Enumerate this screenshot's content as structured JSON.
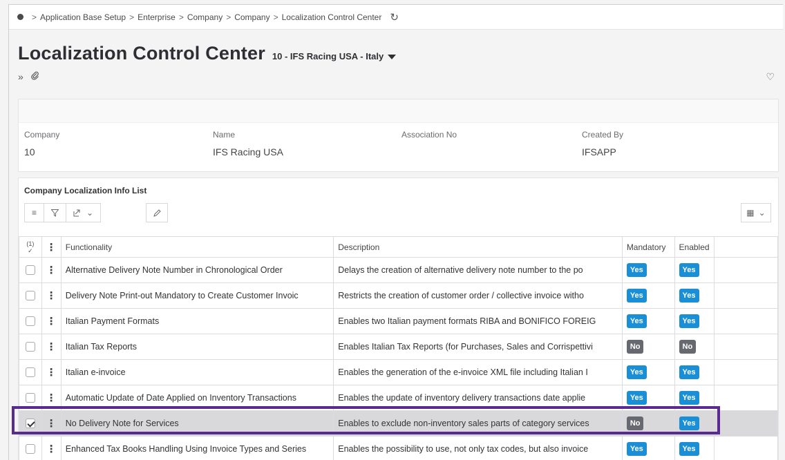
{
  "breadcrumb": [
    "Application Base Setup",
    "Enterprise",
    "Company",
    "Company",
    "Localization Control Center"
  ],
  "page": {
    "title": "Localization Control Center",
    "context": "10 - IFS Racing USA - Italy"
  },
  "header_fields": [
    {
      "label": "Company",
      "value": "10"
    },
    {
      "label": "Name",
      "value": "IFS Racing USA"
    },
    {
      "label": "Association No",
      "value": ""
    },
    {
      "label": "Created By",
      "value": "IFSAPP"
    }
  ],
  "list": {
    "title": "Company Localization Info List",
    "selection_count": "(1)",
    "columns": [
      "Functionality",
      "Description",
      "Mandatory",
      "Enabled"
    ],
    "rows": [
      {
        "functionality": "Alternative Delivery Note Number in Chronological Order",
        "description": "Delays the creation of alternative delivery note number to the po",
        "mandatory": "Yes",
        "enabled": "Yes",
        "checked": false
      },
      {
        "functionality": "Delivery Note Print-out Mandatory to Create Customer Invoic",
        "description": "Restricts the creation of customer order / collective invoice witho",
        "mandatory": "Yes",
        "enabled": "Yes",
        "checked": false
      },
      {
        "functionality": "Italian Payment Formats",
        "description": "Enables two Italian payment formats RIBA and BONIFICO FOREIG",
        "mandatory": "Yes",
        "enabled": "Yes",
        "checked": false
      },
      {
        "functionality": "Italian Tax Reports",
        "description": "Enables Italian Tax Reports (for Purchases, Sales and Corrispettivi",
        "mandatory": "No",
        "enabled": "No",
        "checked": false
      },
      {
        "functionality": "Italian e-invoice",
        "description": "Enables the generation of the e-invoice XML file including Italian I",
        "mandatory": "Yes",
        "enabled": "Yes",
        "checked": false
      },
      {
        "functionality": "Automatic Update of Date Applied on Inventory Transactions",
        "description": "Enables the update of inventory delivery transactions date applie",
        "mandatory": "Yes",
        "enabled": "Yes",
        "checked": false
      },
      {
        "functionality": "No Delivery Note for Services",
        "description": "Enables to exclude non-inventory sales parts of category services",
        "mandatory": "No",
        "enabled": "Yes",
        "checked": true
      },
      {
        "functionality": "Enhanced Tax Books Handling Using Invoice Types and Series",
        "description": "Enables the possibility to use, not only tax codes, but also invoice",
        "mandatory": "Yes",
        "enabled": "Yes",
        "checked": false
      }
    ]
  },
  "colors": {
    "yes": "#1a8fd6",
    "no": "#666a70",
    "highlight": "#5b2a91"
  }
}
